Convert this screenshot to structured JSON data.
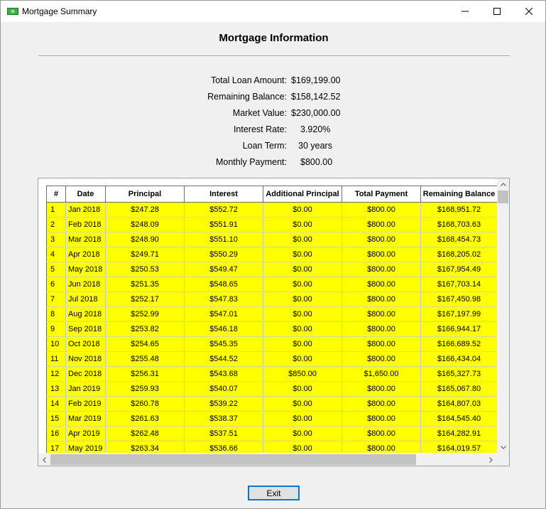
{
  "window": {
    "title": "Mortgage Summary",
    "icon": "money-bill-icon"
  },
  "heading": "Mortgage Information",
  "info": [
    {
      "label": "Total Loan Amount:",
      "value": "$169,199.00"
    },
    {
      "label": "Remaining Balance:",
      "value": "$158,142.52"
    },
    {
      "label": "Market Value:",
      "value": "$230,000.00"
    },
    {
      "label": "Interest Rate:",
      "value": "3.920%"
    },
    {
      "label": "Loan Term:",
      "value": "30 years"
    },
    {
      "label": "Monthly Payment:",
      "value": "$800.00"
    }
  ],
  "table": {
    "columns": [
      "#",
      "Date",
      "Principal",
      "Interest",
      "Additional Principal",
      "Total Payment",
      "Remaining Balance"
    ],
    "rows": [
      [
        "1",
        "Jan 2018",
        "$247.28",
        "$552.72",
        "$0.00",
        "$800.00",
        "$168,951.72"
      ],
      [
        "2",
        "Feb 2018",
        "$248.09",
        "$551.91",
        "$0.00",
        "$800.00",
        "$168,703.63"
      ],
      [
        "3",
        "Mar 2018",
        "$248.90",
        "$551.10",
        "$0.00",
        "$800.00",
        "$168,454.73"
      ],
      [
        "4",
        "Apr 2018",
        "$249.71",
        "$550.29",
        "$0.00",
        "$800.00",
        "$168,205.02"
      ],
      [
        "5",
        "May 2018",
        "$250.53",
        "$549.47",
        "$0.00",
        "$800.00",
        "$167,954.49"
      ],
      [
        "6",
        "Jun 2018",
        "$251.35",
        "$548.65",
        "$0.00",
        "$800.00",
        "$167,703.14"
      ],
      [
        "7",
        "Jul 2018",
        "$252.17",
        "$547.83",
        "$0.00",
        "$800.00",
        "$167,450.98"
      ],
      [
        "8",
        "Aug 2018",
        "$252.99",
        "$547.01",
        "$0.00",
        "$800.00",
        "$167,197.99"
      ],
      [
        "9",
        "Sep 2018",
        "$253.82",
        "$546.18",
        "$0.00",
        "$800.00",
        "$166,944.17"
      ],
      [
        "10",
        "Oct 2018",
        "$254.65",
        "$545.35",
        "$0.00",
        "$800.00",
        "$166,689.52"
      ],
      [
        "11",
        "Nov 2018",
        "$255.48",
        "$544.52",
        "$0.00",
        "$800.00",
        "$166,434.04"
      ],
      [
        "12",
        "Dec 2018",
        "$256.31",
        "$543.68",
        "$850.00",
        "$1,650.00",
        "$165,327.73"
      ],
      [
        "13",
        "Jan 2019",
        "$259.93",
        "$540.07",
        "$0.00",
        "$800.00",
        "$165,067.80"
      ],
      [
        "14",
        "Feb 2019",
        "$260.78",
        "$539.22",
        "$0.00",
        "$800.00",
        "$164,807.03"
      ],
      [
        "15",
        "Mar 2019",
        "$261.63",
        "$538.37",
        "$0.00",
        "$800.00",
        "$164,545.40"
      ],
      [
        "16",
        "Apr 2019",
        "$262.48",
        "$537.51",
        "$0.00",
        "$800.00",
        "$164,282.91"
      ],
      [
        "17",
        "May 2019",
        "$263.34",
        "$536.66",
        "$0.00",
        "$800.00",
        "$164,019.57"
      ]
    ]
  },
  "exit_label": "Exit",
  "colors": {
    "row_highlight": "#ffff00",
    "focus_border": "#0078d7",
    "icon_green": "#3cb043"
  }
}
